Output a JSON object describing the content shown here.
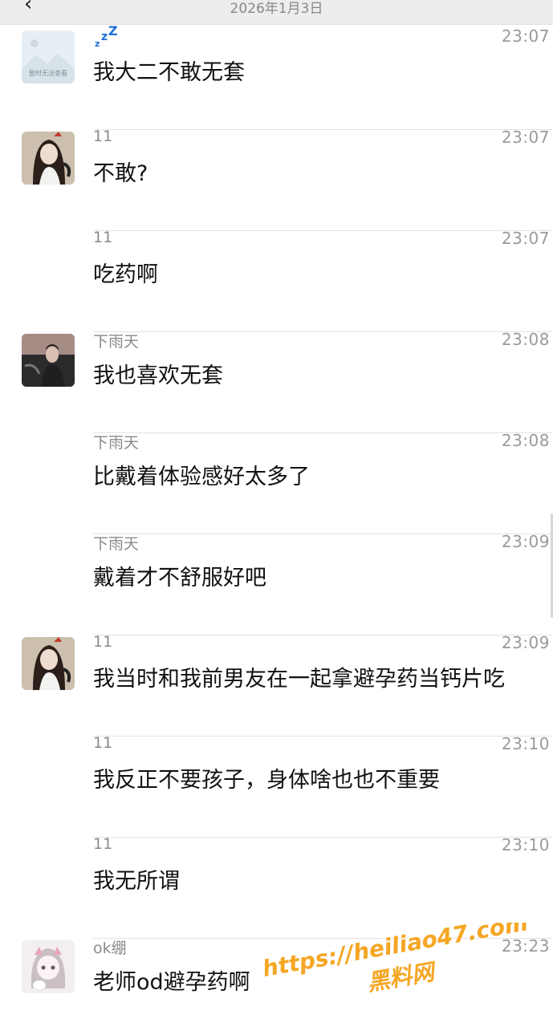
{
  "header": {
    "back_icon": "chevron-left-icon",
    "date": "2026年1月3日"
  },
  "messages": [
    {
      "name": "",
      "time": "23:07",
      "text": "我大二不敢无套",
      "avatar": "placeholder-image"
    },
    {
      "name": "11",
      "time": "23:07",
      "text": "不敢?",
      "avatar": "girl-photo"
    },
    {
      "name": "11",
      "time": "23:07",
      "text": "吃药啊",
      "avatar": ""
    },
    {
      "name": "下雨天",
      "time": "23:08",
      "text": "我也喜欢无套",
      "avatar": "man-in-car-photo"
    },
    {
      "name": "下雨天",
      "time": "23:08",
      "text": "比戴着体验感好太多了",
      "avatar": ""
    },
    {
      "name": "下雨天",
      "time": "23:09",
      "text": "戴着才不舒服好吧",
      "avatar": ""
    },
    {
      "name": "11",
      "time": "23:09",
      "text": "我当时和我前男友在一起拿避孕药当钙片吃",
      "avatar": "girl-photo"
    },
    {
      "name": "11",
      "time": "23:10",
      "text": "我反正不要孩子，身体啥也也不重要",
      "avatar": ""
    },
    {
      "name": "11",
      "time": "23:10",
      "text": "我无所谓",
      "avatar": ""
    },
    {
      "name": "ok绷",
      "time": "23:23",
      "text": "老师od避孕药啊",
      "avatar": "anime-girl-avatar"
    }
  ],
  "placeholder_avatar_text": "暂时无法查看",
  "watermark": {
    "line1": "https://heiliao47.com",
    "line2": "黑料网",
    "color": "#f5a623"
  }
}
